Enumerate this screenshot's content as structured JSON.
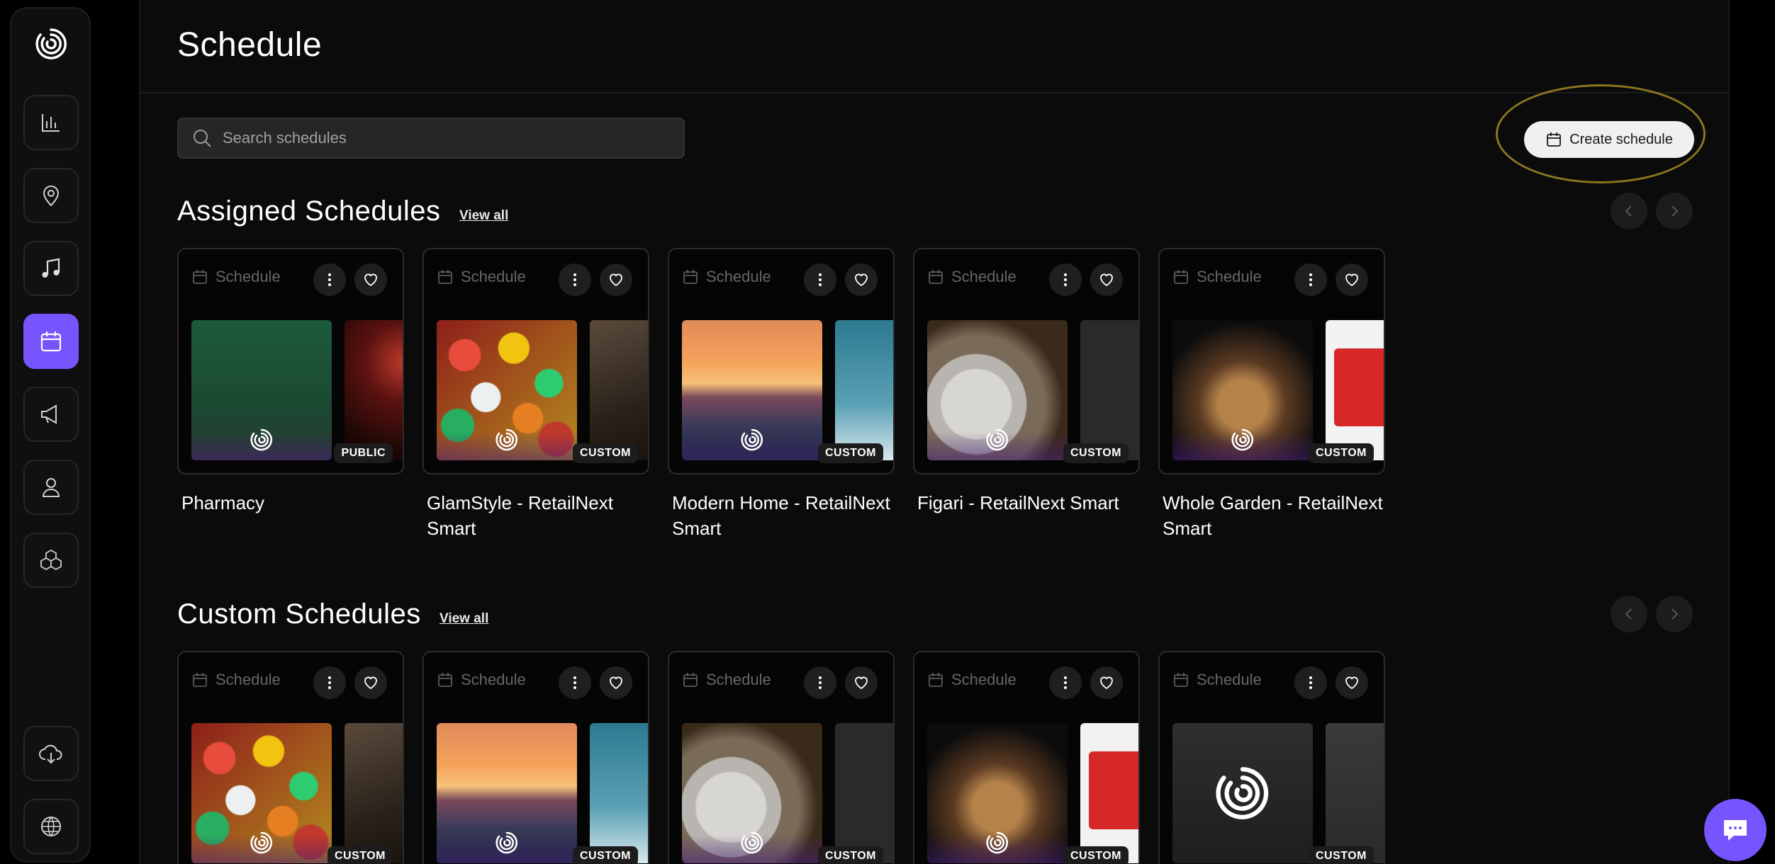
{
  "page": {
    "title": "Schedule"
  },
  "search": {
    "placeholder": "Search schedules",
    "value": ""
  },
  "create_button": {
    "label": "Create schedule"
  },
  "sidebar": {
    "items": [
      {
        "icon": "analytics-icon"
      },
      {
        "icon": "location-pin-icon"
      },
      {
        "icon": "music-note-icon"
      },
      {
        "icon": "calendar-icon",
        "active": true
      },
      {
        "icon": "megaphone-icon"
      },
      {
        "icon": "user-icon"
      },
      {
        "icon": "cubes-icon"
      },
      {
        "icon": "cloud-download-icon"
      },
      {
        "icon": "globe-icon"
      }
    ],
    "accent": "#7655ff"
  },
  "assigned": {
    "title": "Assigned Schedules",
    "view_all": "View all",
    "cards": [
      {
        "type_label": "Schedule",
        "badge": "PUBLIC",
        "name": "Pharmacy"
      },
      {
        "type_label": "Schedule",
        "badge": "CUSTOM",
        "name": "GlamStyle - RetailNext Smart"
      },
      {
        "type_label": "Schedule",
        "badge": "CUSTOM",
        "name": "Modern Home - RetailNext Smart"
      },
      {
        "type_label": "Schedule",
        "badge": "CUSTOM",
        "name": "Figari - RetailNext Smart"
      },
      {
        "type_label": "Schedule",
        "badge": "CUSTOM",
        "name": "Whole Garden - RetailNext Smart"
      }
    ]
  },
  "custom": {
    "title": "Custom Schedules",
    "view_all": "View all",
    "cards": [
      {
        "type_label": "Schedule",
        "badge": "CUSTOM"
      },
      {
        "type_label": "Schedule",
        "badge": "CUSTOM"
      },
      {
        "type_label": "Schedule",
        "badge": "CUSTOM"
      },
      {
        "type_label": "Schedule",
        "badge": "CUSTOM"
      },
      {
        "type_label": "Schedule",
        "badge": "CUSTOM"
      }
    ]
  },
  "colors": {
    "highlight_ring": "#8a7620",
    "accent": "#7655ff"
  }
}
